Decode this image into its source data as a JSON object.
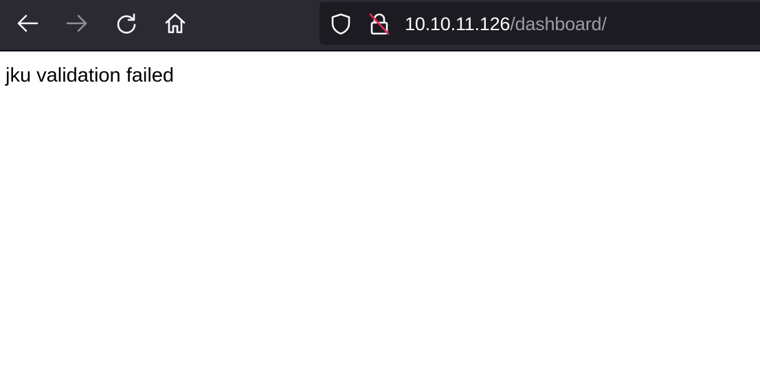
{
  "browser": {
    "toolbar_bg": "#2b2a33",
    "urlbar_bg": "#1c1b22",
    "buttons": {
      "back_icon": "arrow-left-icon",
      "forward_icon": "arrow-right-icon",
      "reload_icon": "reload-icon",
      "home_icon": "home-icon"
    },
    "urlbar": {
      "host": "10.10.11.126",
      "path": "/dashboard/",
      "tracking_icon": "shield-icon",
      "security_icon": "insecure-lock-icon"
    }
  },
  "page": {
    "message": "jku validation failed"
  }
}
